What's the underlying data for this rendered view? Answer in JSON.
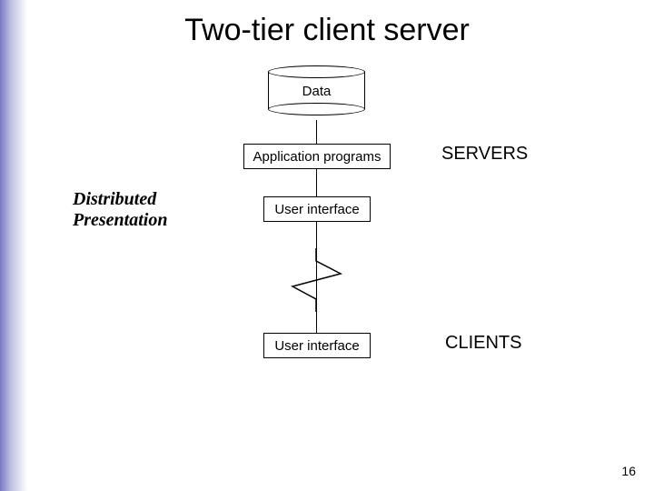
{
  "title": "Two-tier client server",
  "page_number": "16",
  "diagram": {
    "data_label": "Data",
    "app_label": "Application programs",
    "ui_top_label": "User interface",
    "ui_bottom_label": "User interface",
    "servers_label": "SERVERS",
    "clients_label": "CLIENTS",
    "distributed_line1": "Distributed",
    "distributed_line2": "Presentation"
  }
}
